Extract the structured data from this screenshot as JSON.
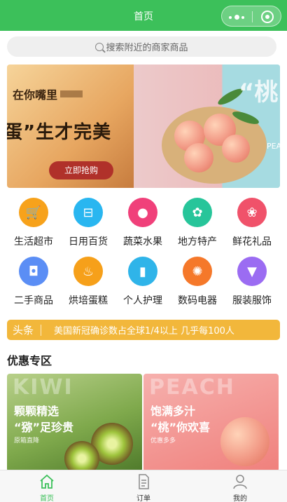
{
  "nav": {
    "title": "首页"
  },
  "search": {
    "placeholder": "搜索附近的商家商品"
  },
  "banner": {
    "left_line1": "在你嘴里",
    "left_line2": "蛋”生才完美",
    "button": "立即抢购",
    "right_big": "“桃",
    "right_small": "PEACH"
  },
  "categories": [
    {
      "label": "生活超市",
      "icon": "cart-icon",
      "color": "#f7a21b"
    },
    {
      "label": "日用百货",
      "icon": "basket-icon",
      "color": "#29b6f0"
    },
    {
      "label": "蔬菜水果",
      "icon": "apple-icon",
      "color": "#f0407a"
    },
    {
      "label": "地方特产",
      "icon": "leaf-icon",
      "color": "#27c59a"
    },
    {
      "label": "鲜花礼品",
      "icon": "flower-icon",
      "color": "#f0526a"
    },
    {
      "label": "二手商品",
      "icon": "bag-icon",
      "color": "#5b8ef5"
    },
    {
      "label": "烘培蛋糕",
      "icon": "cake-icon",
      "color": "#f6a01a"
    },
    {
      "label": "个人护理",
      "icon": "bottle-icon",
      "color": "#2fb4e9"
    },
    {
      "label": "数码电器",
      "icon": "fan-icon",
      "color": "#f5782a"
    },
    {
      "label": "服装服饰",
      "icon": "shirt-icon",
      "color": "#9b6cf2"
    }
  ],
  "headline": {
    "tag": "头条",
    "text": "美国新冠确诊数占全球1/4以上 几乎每100人"
  },
  "section": {
    "title": "优惠专区"
  },
  "promos": [
    {
      "bg": "KIWI",
      "line1": "颗颗精选",
      "line2": "“猕”足珍贵",
      "sub": "原箱直降"
    },
    {
      "bg": "PEACH",
      "line1": "饱满多汁",
      "line2": "“桃”你欢喜",
      "sub": "优惠多多"
    }
  ],
  "tabs": [
    {
      "label": "首页",
      "icon": "home-icon",
      "active": true
    },
    {
      "label": "订单",
      "icon": "order-icon",
      "active": false
    },
    {
      "label": "我的",
      "icon": "user-icon",
      "active": false
    }
  ],
  "colors": {
    "brand": "#3cc05a",
    "headline": "#f2b73b"
  }
}
